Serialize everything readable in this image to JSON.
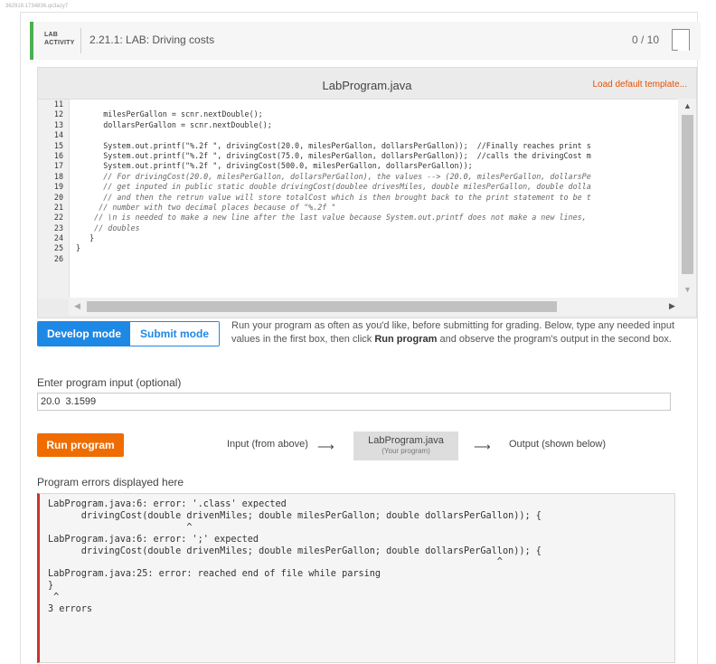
{
  "frame_id": "362918.1734836.qx3azy7",
  "header": {
    "tag_line1": "LAB",
    "tag_line2": "ACTIVITY",
    "title": "2.21.1: LAB: Driving costs",
    "score": "0 / 10"
  },
  "editor": {
    "file_name": "LabProgram.java",
    "load_default": "Load default template...",
    "line_numbers": [
      "11",
      "12",
      "13",
      "14",
      "15",
      "16",
      "17",
      "18",
      "19",
      "20",
      "21",
      "22",
      "23",
      "24",
      "25",
      "26"
    ],
    "lines": [
      {
        "text": "",
        "comment": false
      },
      {
        "text": "      milesPerGallon = scnr.nextDouble();",
        "comment": false
      },
      {
        "text": "      dollarsPerGallon = scnr.nextDouble();",
        "comment": false
      },
      {
        "text": "",
        "comment": false
      },
      {
        "text": "      System.out.printf(\"%.2f \", drivingCost(20.0, milesPerGallon, dollarsPerGallon));  //Finally reaches print s",
        "comment": false
      },
      {
        "text": "      System.out.printf(\"%.2f \", drivingCost(75.0, milesPerGallon, dollarsPerGallon));  //calls the drivingCost m",
        "comment": false
      },
      {
        "text": "      System.out.printf(\"%.2f \", drivingCost(500.0, milesPerGallon, dollarsPerGallon));",
        "comment": false
      },
      {
        "text": "      // For drivingCost(20.0, milesPerGallon, dollarsPerGallon), the values --> (20.0, milesPerGallon, dollarsPe",
        "comment": true
      },
      {
        "text": "      // get inputed in public static double drivingCost(doublee drivesMiles, double milesPerGallon, double dolla",
        "comment": true
      },
      {
        "text": "      // and then the retrun value will store totalCost which is then brought back to the print statement to be t",
        "comment": true
      },
      {
        "text": "     // number with two decimal places because of \"%.2f \"",
        "comment": true
      },
      {
        "text": "    // \\n is needed to make a new line after the last value because System.out.printf does not make a new lines,",
        "comment": true
      },
      {
        "text": "    // doubles",
        "comment": true
      },
      {
        "text": "   }",
        "comment": false
      },
      {
        "text": "}",
        "comment": false
      },
      {
        "text": "",
        "comment": false
      }
    ]
  },
  "modes": {
    "develop": "Develop mode",
    "submit": "Submit mode",
    "desc_pre": "Run your program as often as you'd like, before submitting for grading. Below, type any needed input values in the first box, then click ",
    "desc_bold": "Run program",
    "desc_post": " and observe the program's output in the second box."
  },
  "input": {
    "label": "Enter program input (optional)",
    "value": "20.0  3.1599"
  },
  "run": {
    "button": "Run program",
    "flow_input": "Input (from above)",
    "flow_box_title": "LabProgram.java",
    "flow_box_sub": "(Your program)",
    "flow_output": "Output (shown below)"
  },
  "errors": {
    "label": "Program errors displayed here",
    "lines": [
      "LabProgram.java:6: error: '.class' expected",
      "      drivingCost(double drivenMiles; double milesPerGallon; double dollarsPerGallon)); {",
      "                         ^",
      "LabProgram.java:6: error: ';' expected",
      "      drivingCost(double drivenMiles; double milesPerGallon; double dollarsPerGallon)); {",
      "                                                                                 ^",
      "LabProgram.java:25: error: reached end of file while parsing",
      "}",
      " ^",
      "3 errors"
    ]
  }
}
